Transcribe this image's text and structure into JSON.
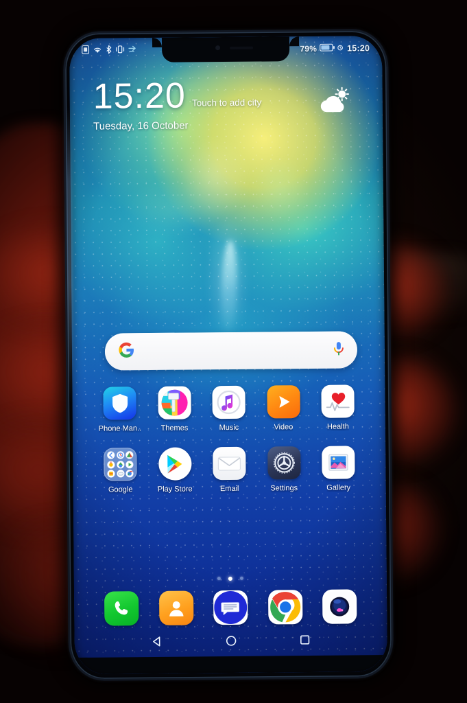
{
  "device": {
    "type": "smartphone",
    "orientation": "portrait",
    "context": "phone held in a hand in a dark room"
  },
  "status_bar": {
    "left_icons": [
      "sim-card-icon",
      "wifi-icon",
      "bluetooth-icon",
      "vibrate-icon",
      "data-transfer-icon"
    ],
    "battery_percent": "79%",
    "battery_icon": "battery-icon",
    "alarm_icon": "alarm-icon",
    "time": "15:20"
  },
  "clock_widget": {
    "time": "15:20",
    "city_hint": "Touch to add city",
    "date": "Tuesday, 16 October",
    "weather_icon": "sun-behind-cloud-icon"
  },
  "search": {
    "provider_icon": "google-g-icon",
    "value": "",
    "placeholder": "",
    "voice_icon": "microphone-icon"
  },
  "home_screen": {
    "rows": [
      [
        {
          "label": "Phone Man..",
          "icon": "shield-icon",
          "style": "phonemgr"
        },
        {
          "label": "Themes",
          "icon": "paint-brush-icon",
          "style": "themes"
        },
        {
          "label": "Music",
          "icon": "music-note-icon",
          "style": "music"
        },
        {
          "label": "Video",
          "icon": "play-triangle-icon",
          "style": "video"
        },
        {
          "label": "Health",
          "icon": "heart-ecg-icon",
          "style": "health"
        }
      ],
      [
        {
          "label": "Google",
          "icon": "folder-icon",
          "style": "google"
        },
        {
          "label": "Play Store",
          "icon": "play-store-icon",
          "style": "play"
        },
        {
          "label": "Email",
          "icon": "envelope-icon",
          "style": "email"
        },
        {
          "label": "Settings",
          "icon": "gear-icon",
          "style": "settings"
        },
        {
          "label": "Gallery",
          "icon": "photo-frame-icon",
          "style": "gallery"
        }
      ]
    ],
    "page_dots": {
      "count": 3,
      "active_index": 1
    }
  },
  "dock": [
    {
      "label": "Phone",
      "icon": "phone-handset-icon",
      "style": "phone"
    },
    {
      "label": "Contacts",
      "icon": "person-icon",
      "style": "contacts"
    },
    {
      "label": "Messages",
      "icon": "speech-bubble-icon",
      "style": "msg"
    },
    {
      "label": "Chrome",
      "icon": "chrome-icon",
      "style": "chrome"
    },
    {
      "label": "Camera",
      "icon": "camera-lens-icon",
      "style": "camera"
    }
  ],
  "nav_bar": {
    "back_icon": "back-triangle-icon",
    "home_icon": "home-circle-icon",
    "recents_icon": "recents-square-icon"
  },
  "colors": {
    "wallpaper_teal": "#1e8fb0",
    "wallpaper_yellow": "#f6ef7a",
    "wallpaper_blue": "#0b2487",
    "status_text": "#eef6ff",
    "label_text": "#ffffff"
  }
}
